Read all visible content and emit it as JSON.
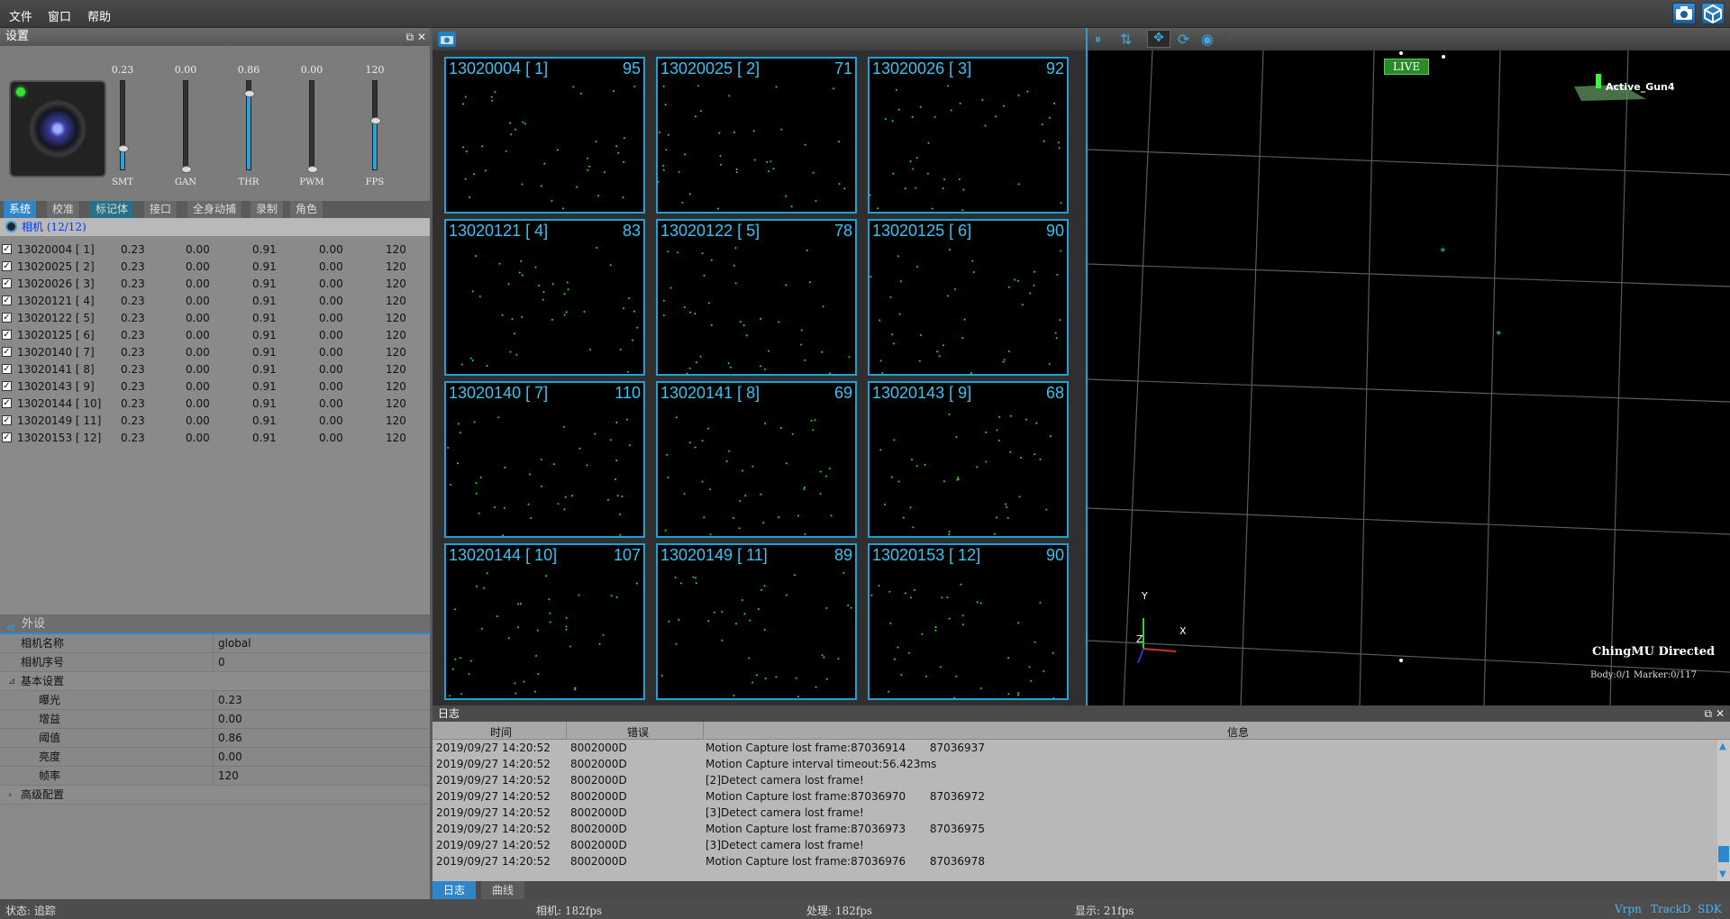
{
  "menu": {
    "file": "文件",
    "window": "窗口",
    "help": "帮助"
  },
  "settings_panel": {
    "title": "设置",
    "sliders": [
      {
        "label": "SMT",
        "value_text": "0.23",
        "level": 0.23
      },
      {
        "label": "GAN",
        "value_text": "0.00",
        "level": 0.0
      },
      {
        "label": "THR",
        "value_text": "0.86",
        "level": 0.86
      },
      {
        "label": "PWM",
        "value_text": "0.00",
        "level": 0.0
      },
      {
        "label": "FPS",
        "value_text": "120",
        "level": 0.55
      }
    ],
    "tabs": [
      "系统",
      "校准",
      "标记体",
      "接口",
      "全身动捕",
      "录制",
      "角色"
    ],
    "camera_header": "相机 (12/12)",
    "cameras": [
      {
        "name": "13020004 [  1]",
        "c1": "0.23",
        "c2": "0.00",
        "c3": "0.91",
        "c4": "0.00",
        "c5": "120"
      },
      {
        "name": "13020025 [  2]",
        "c1": "0.23",
        "c2": "0.00",
        "c3": "0.91",
        "c4": "0.00",
        "c5": "120"
      },
      {
        "name": "13020026 [  3]",
        "c1": "0.23",
        "c2": "0.00",
        "c3": "0.91",
        "c4": "0.00",
        "c5": "120"
      },
      {
        "name": "13020121 [  4]",
        "c1": "0.23",
        "c2": "0.00",
        "c3": "0.91",
        "c4": "0.00",
        "c5": "120"
      },
      {
        "name": "13020122 [  5]",
        "c1": "0.23",
        "c2": "0.00",
        "c3": "0.91",
        "c4": "0.00",
        "c5": "120"
      },
      {
        "name": "13020125 [  6]",
        "c1": "0.23",
        "c2": "0.00",
        "c3": "0.91",
        "c4": "0.00",
        "c5": "120"
      },
      {
        "name": "13020140 [  7]",
        "c1": "0.23",
        "c2": "0.00",
        "c3": "0.91",
        "c4": "0.00",
        "c5": "120"
      },
      {
        "name": "13020141 [  8]",
        "c1": "0.23",
        "c2": "0.00",
        "c3": "0.91",
        "c4": "0.00",
        "c5": "120"
      },
      {
        "name": "13020143 [  9]",
        "c1": "0.23",
        "c2": "0.00",
        "c3": "0.91",
        "c4": "0.00",
        "c5": "120"
      },
      {
        "name": "13020144 [ 10]",
        "c1": "0.23",
        "c2": "0.00",
        "c3": "0.91",
        "c4": "0.00",
        "c5": "120"
      },
      {
        "name": "13020149 [ 11]",
        "c1": "0.23",
        "c2": "0.00",
        "c3": "0.91",
        "c4": "0.00",
        "c5": "120"
      },
      {
        "name": "13020153 [ 12]",
        "c1": "0.23",
        "c2": "0.00",
        "c3": "0.91",
        "c4": "0.00",
        "c5": "120"
      }
    ]
  },
  "peripheral": {
    "title": "外设",
    "rows": [
      {
        "key": "相机名称",
        "value": "global",
        "group": false
      },
      {
        "key": "相机序号",
        "value": "0",
        "group": false
      },
      {
        "key": "基本设置",
        "value": "",
        "group": true,
        "expander": "⊿"
      },
      {
        "key": "曝光",
        "value": "0.23",
        "group": false
      },
      {
        "key": "增益",
        "value": "0.00",
        "group": false
      },
      {
        "key": "阈值",
        "value": "0.86",
        "group": false
      },
      {
        "key": "亮度",
        "value": "0.00",
        "group": false
      },
      {
        "key": "帧率",
        "value": "120",
        "group": false
      },
      {
        "key": "高级配置",
        "value": "",
        "group": true,
        "expander": "›"
      }
    ]
  },
  "camera_grid": [
    {
      "name": "13020004 [ 1]",
      "fps": "95"
    },
    {
      "name": "13020025 [ 2]",
      "fps": "71"
    },
    {
      "name": "13020026 [ 3]",
      "fps": "92"
    },
    {
      "name": "13020121 [ 4]",
      "fps": "83"
    },
    {
      "name": "13020122 [ 5]",
      "fps": "78"
    },
    {
      "name": "13020125 [ 6]",
      "fps": "90"
    },
    {
      "name": "13020140 [ 7]",
      "fps": "110"
    },
    {
      "name": "13020141 [ 8]",
      "fps": "69"
    },
    {
      "name": "13020143 [ 9]",
      "fps": "68"
    },
    {
      "name": "13020144 [ 10]",
      "fps": "107"
    },
    {
      "name": "13020149 [ 11]",
      "fps": "89"
    },
    {
      "name": "13020153 [ 12]",
      "fps": "90"
    }
  ],
  "viewport": {
    "live": "LIVE",
    "rigid_label": "Active_Gun4",
    "brand": "ChingMU Directed",
    "stats": "Body:0/1  Marker:0/117",
    "axis_y": "Y",
    "axis_z": "Z",
    "axis_x": "X"
  },
  "log": {
    "title": "日志",
    "headers": {
      "time": "时间",
      "error": "错误",
      "info": "信息"
    },
    "rows": [
      {
        "time": "2019/09/27 14:20:52",
        "error": "8002000D",
        "info": "Motion Capture lost frame:87036914       87036937"
      },
      {
        "time": "2019/09/27 14:20:52",
        "error": "8002000D",
        "info": "Motion Capture interval timeout:56.423ms"
      },
      {
        "time": "2019/09/27 14:20:52",
        "error": "8002000D",
        "info": "[2]Detect camera lost frame!"
      },
      {
        "time": "2019/09/27 14:20:52",
        "error": "8002000D",
        "info": "Motion Capture lost frame:87036970       87036972"
      },
      {
        "time": "2019/09/27 14:20:52",
        "error": "8002000D",
        "info": "[3]Detect camera lost frame!"
      },
      {
        "time": "2019/09/27 14:20:52",
        "error": "8002000D",
        "info": "Motion Capture lost frame:87036973       87036975"
      },
      {
        "time": "2019/09/27 14:20:52",
        "error": "8002000D",
        "info": "[3]Detect camera lost frame!"
      },
      {
        "time": "2019/09/27 14:20:52",
        "error": "8002000D",
        "info": "Motion Capture lost frame:87036976       87036978"
      }
    ],
    "tabs": [
      "日志",
      "曲线"
    ]
  },
  "status": {
    "state": "状态: 追踪",
    "camera": "相机: 182fps",
    "process": "处理: 182fps",
    "display": "显示: 21fps",
    "links": [
      "Vrpn",
      "TrackD",
      "SDK"
    ]
  },
  "colors": {
    "accent": "#1ca2d8",
    "marker": "#33dd33",
    "live": "#2a8a2a"
  }
}
